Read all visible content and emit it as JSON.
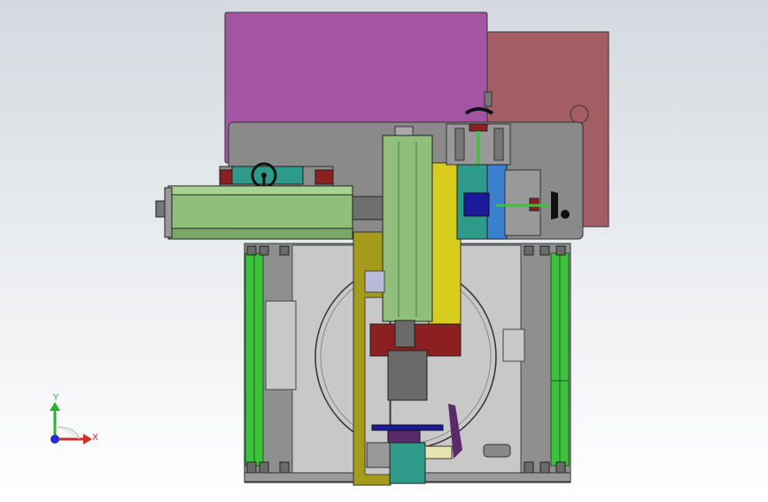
{
  "viewport": {
    "background_top": "#d4d9df",
    "background_bottom": "#ffffff"
  },
  "model": {
    "description_icon": "cad-machine-assembly-icon",
    "colors": {
      "magenta_plate": "#a354a3",
      "rose_plate": "#a35e63",
      "dark_gray_plate": "#8a8a8a",
      "light_gray_base": "#c8c8c8",
      "green_part": "#8fbf7a",
      "bright_green": "#3cc23c",
      "olive": "#a59b1a",
      "yellow": "#d8cd1c",
      "dark_red": "#8c1f1f",
      "teal": "#2e9a8a",
      "blue": "#3a7fd0",
      "navy": "#1a1a9a",
      "purple": "#5a2a6a",
      "black": "#1a1a1a"
    }
  },
  "triad": {
    "x_label": "X",
    "y_label": "Y",
    "x_color": "#d22b2b",
    "y_color": "#2bb02b",
    "z_color": "#2b2bd2"
  }
}
